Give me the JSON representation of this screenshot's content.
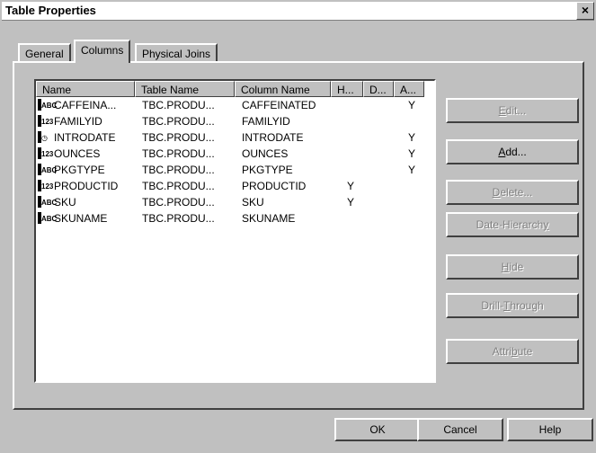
{
  "window": {
    "title": "Table Properties",
    "close_glyph": "×"
  },
  "tabs": [
    {
      "label": "General",
      "active": false
    },
    {
      "label": "Columns",
      "active": true
    },
    {
      "label": "Physical Joins",
      "active": false
    }
  ],
  "list": {
    "headers": [
      "Name",
      "Table Name",
      "Column Name",
      "H...",
      "D...",
      "A..."
    ],
    "rows": [
      {
        "icon": "abc-type-icon",
        "icon_text": "ABC",
        "name": "CAFFEINA...",
        "table": "TBC.PRODU...",
        "column": "CAFFEINATED",
        "h": "",
        "d": "",
        "a": "Y"
      },
      {
        "icon": "numeric-type-icon",
        "icon_text": "123",
        "name": "FAMILYID",
        "table": "TBC.PRODU...",
        "column": "FAMILYID",
        "h": "",
        "d": "",
        "a": ""
      },
      {
        "icon": "date-type-icon",
        "icon_text": "◷",
        "name": "INTRODATE",
        "table": "TBC.PRODU...",
        "column": "INTRODATE",
        "h": "",
        "d": "",
        "a": "Y"
      },
      {
        "icon": "numeric-type-icon",
        "icon_text": "123",
        "name": "OUNCES",
        "table": "TBC.PRODU...",
        "column": "OUNCES",
        "h": "",
        "d": "",
        "a": "Y"
      },
      {
        "icon": "abc-type-icon",
        "icon_text": "ABC",
        "name": "PKGTYPE",
        "table": "TBC.PRODU...",
        "column": "PKGTYPE",
        "h": "",
        "d": "",
        "a": "Y"
      },
      {
        "icon": "numeric-type-icon",
        "icon_text": "123",
        "name": "PRODUCTID",
        "table": "TBC.PRODU...",
        "column": "PRODUCTID",
        "h": "Y",
        "d": "",
        "a": ""
      },
      {
        "icon": "abc-type-icon",
        "icon_text": "ABC",
        "name": "SKU",
        "table": "TBC.PRODU...",
        "column": "SKU",
        "h": "Y",
        "d": "",
        "a": ""
      },
      {
        "icon": "abc-type-icon",
        "icon_text": "ABC",
        "name": "SKUNAME",
        "table": "TBC.PRODU...",
        "column": "SKUNAME",
        "h": "",
        "d": "",
        "a": ""
      }
    ]
  },
  "side_buttons": {
    "edit": {
      "pre": "",
      "u": "E",
      "post": "dit..."
    },
    "add": {
      "pre": "",
      "u": "A",
      "post": "dd..."
    },
    "delete": {
      "pre": "",
      "u": "D",
      "post": "elete..."
    },
    "date_hierarchy": {
      "pre": "Date-Hierarch",
      "u": "y",
      "post": ""
    },
    "hide": {
      "pre": "",
      "u": "H",
      "post": "ide"
    },
    "drill_through": {
      "pre": "Drill-",
      "u": "T",
      "post": "hrough"
    },
    "attribute": {
      "pre": "Attri",
      "u": "b",
      "post": "ute"
    }
  },
  "bottom_buttons": {
    "ok": "OK",
    "cancel": "Cancel",
    "help": "Help"
  }
}
